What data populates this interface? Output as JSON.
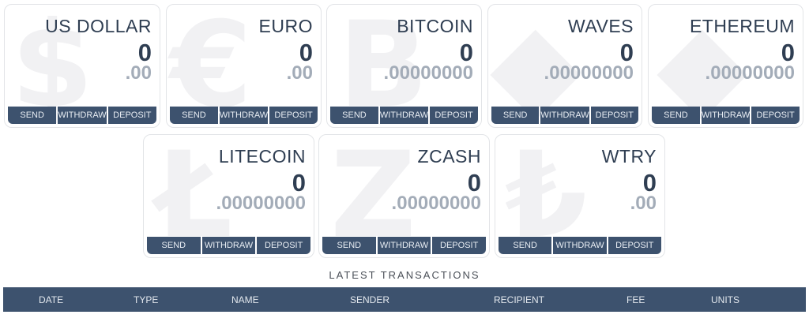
{
  "wallets": [
    {
      "name": "US DOLLAR",
      "integer": "0",
      "decimals": ".00",
      "icon": "dollar-icon",
      "symbol": "$"
    },
    {
      "name": "EURO",
      "integer": "0",
      "decimals": ".00",
      "icon": "euro-icon",
      "symbol": "€"
    },
    {
      "name": "BITCOIN",
      "integer": "0",
      "decimals": ".00000000",
      "icon": "bitcoin-icon",
      "symbol": "B"
    },
    {
      "name": "WAVES",
      "integer": "0",
      "decimals": ".00000000",
      "icon": "waves-icon",
      "symbol": "◆"
    },
    {
      "name": "ETHEREUM",
      "integer": "0",
      "decimals": ".00000000",
      "icon": "ethereum-icon",
      "symbol": "◆"
    },
    {
      "name": "LITECOIN",
      "integer": "0",
      "decimals": ".00000000",
      "icon": "litecoin-icon",
      "symbol": "Ł"
    },
    {
      "name": "ZCASH",
      "integer": "0",
      "decimals": ".00000000",
      "icon": "zcash-icon",
      "symbol": "Z"
    },
    {
      "name": "WTRY",
      "integer": "0",
      "decimals": ".00",
      "icon": "lira-icon",
      "symbol": "₺"
    }
  ],
  "actions": {
    "send": "SEND",
    "withdraw": "WITHDRAW",
    "deposit": "DEPOSIT"
  },
  "transactions": {
    "title": "LATEST TRANSACTIONS",
    "columns": [
      "DATE",
      "TYPE",
      "NAME",
      "SENDER",
      "RECIPIENT",
      "FEE",
      "UNITS"
    ]
  },
  "colors": {
    "accent": "#3d526e",
    "text": "#2f3e52",
    "muted": "#a3acb8"
  }
}
